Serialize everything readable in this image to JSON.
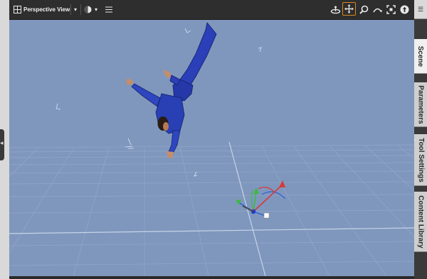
{
  "viewport": {
    "title": "Perspective View",
    "dropdown_glyph": "▾",
    "background": "#7f97bd"
  },
  "toolbar": {
    "left_icons": [
      "viewport-layout-icon",
      "shading-sphere-icon",
      "pane-options-icon"
    ],
    "right_tools": [
      "universal-tool-icon",
      "move-tool-icon",
      "zoom-tool-icon",
      "rotate-tool-icon",
      "frame-tool-icon",
      "aim-tool-icon"
    ],
    "active_tool": "move-tool-icon",
    "active_color": "#d98a1c"
  },
  "panel_tabs": [
    {
      "label": "Scene",
      "active": true
    },
    {
      "label": "Parameters",
      "active": false
    },
    {
      "label": "Tool Settings",
      "active": false
    },
    {
      "label": "Content Library",
      "active": false
    }
  ],
  "gizmo_colors": {
    "x": "#d63a3a",
    "y": "#3fb84a",
    "z": "#2f5fd6"
  }
}
